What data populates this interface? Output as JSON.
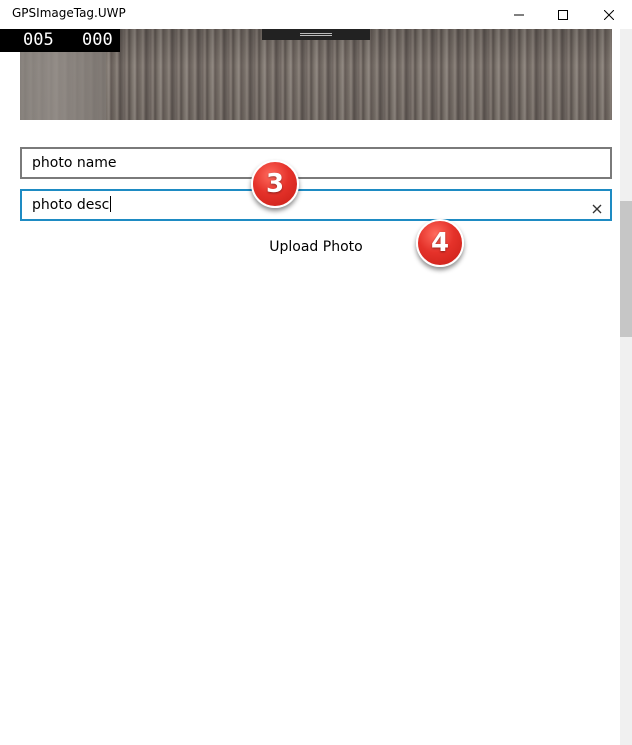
{
  "window": {
    "title": "GPSImageTag.UWP",
    "minimize_icon": "minimize-icon",
    "maximize_icon": "maximize-icon",
    "close_icon": "close-icon"
  },
  "preview": {
    "counter_left": "005",
    "counter_right": "000"
  },
  "form": {
    "name_value": "photo name",
    "desc_value": "photo desc",
    "clear_icon": "clear-icon",
    "upload_label": "Upload Photo",
    "focus_color": "#1e8bc3"
  },
  "annotations": {
    "marker_3": "3",
    "marker_4": "4",
    "marker_color": "#e5322a"
  }
}
